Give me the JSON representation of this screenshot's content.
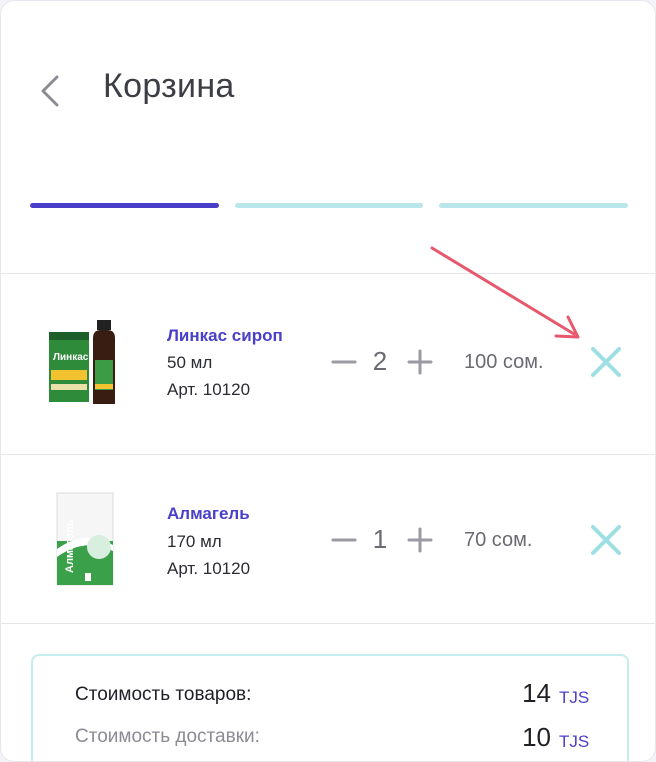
{
  "header": {
    "title": "Корзина",
    "back_icon": "chevron-left-icon"
  },
  "colors": {
    "accent": "#4a3fc9",
    "step_inactive": "#b9e6ea",
    "remove": "#9ddfe4",
    "annotation_arrow": "#e8586d",
    "currency": "#4a3fc9"
  },
  "progress": {
    "steps": [
      {
        "state": "active"
      },
      {
        "state": "inactive"
      },
      {
        "state": "inactive"
      }
    ]
  },
  "cart": {
    "items": [
      {
        "name": "Линкас сироп",
        "volume": "50 мл",
        "article": "Арт. 10120",
        "quantity": "2",
        "price": "100 сом.",
        "image_icon": "linkas-syrup-product-image",
        "image_text": "Линкас"
      },
      {
        "name": "Алмагель",
        "volume": "170 мл",
        "article": "Арт. 10120",
        "quantity": "1",
        "price": "70 сом.",
        "image_icon": "almagel-product-image",
        "image_text": "Алмагель"
      }
    ]
  },
  "summary": {
    "goods_label": "Стоимость товаров:",
    "goods_value": "14",
    "goods_currency": "TJS",
    "delivery_label": "Стоимость доставки:",
    "delivery_value": "10",
    "delivery_currency": "TJS"
  }
}
